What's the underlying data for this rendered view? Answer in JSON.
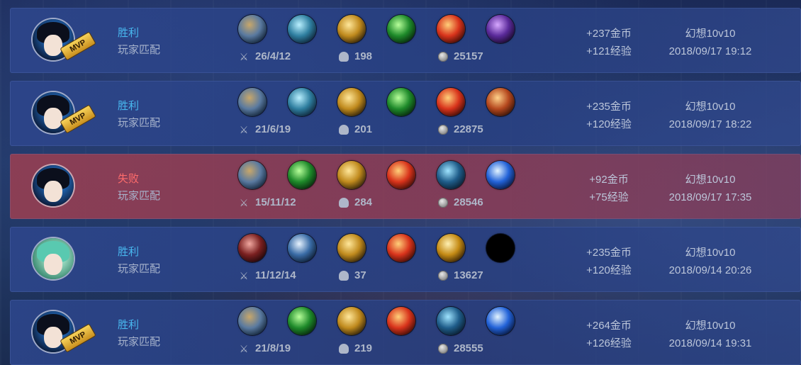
{
  "matches": [
    {
      "result": "胜利",
      "mode": "玩家匹配",
      "mvp": true,
      "mvp_label": "MVP",
      "avatar": "swordsman-portrait",
      "items": [
        "boots",
        "swordb",
        "gold",
        "green",
        "fire",
        "purple"
      ],
      "kda": "26/4/12",
      "deaths_stat": "198",
      "gold_stat": "25157",
      "gold_reward": "+237金币",
      "exp_reward": "+121经验",
      "map": "幻想10v10",
      "time": "2018/09/17 19:12"
    },
    {
      "result": "胜利",
      "mode": "玩家匹配",
      "mvp": true,
      "mvp_label": "MVP",
      "avatar": "swordsman-portrait",
      "items": [
        "boots",
        "swordb",
        "gold",
        "green",
        "fire",
        "amber"
      ],
      "kda": "21/6/19",
      "deaths_stat": "201",
      "gold_stat": "22875",
      "gold_reward": "+235金币",
      "exp_reward": "+120经验",
      "map": "幻想10v10",
      "time": "2018/09/17 18:22"
    },
    {
      "result": "失败",
      "mode": "玩家匹配",
      "mvp": false,
      "mvp_label": "",
      "avatar": "swordsman-portrait",
      "items": [
        "boots",
        "green",
        "gold",
        "fire",
        "bluering",
        "electric"
      ],
      "kda": "15/11/12",
      "deaths_stat": "284",
      "gold_stat": "28546",
      "gold_reward": "+92金币",
      "exp_reward": "+75经验",
      "map": "幻想10v10",
      "time": "2018/09/17 17:35"
    },
    {
      "result": "胜利",
      "mode": "玩家匹配",
      "mvp": false,
      "mvp_label": "",
      "avatar": "green-hair-portrait",
      "items": [
        "redsword",
        "armor",
        "gold",
        "fire",
        "spear",
        "empty"
      ],
      "kda": "11/12/14",
      "deaths_stat": "37",
      "gold_stat": "13627",
      "gold_reward": "+235金币",
      "exp_reward": "+120经验",
      "map": "幻想10v10",
      "time": "2018/09/14 20:26"
    },
    {
      "result": "胜利",
      "mode": "玩家匹配",
      "mvp": true,
      "mvp_label": "MVP",
      "avatar": "swordsman-portrait",
      "items": [
        "boots",
        "green",
        "gold",
        "fire",
        "bluering",
        "electric"
      ],
      "kda": "21/8/19",
      "deaths_stat": "219",
      "gold_stat": "28555",
      "gold_reward": "+264金币",
      "exp_reward": "+126经验",
      "map": "幻想10v10",
      "time": "2018/09/14 19:31"
    }
  ],
  "colors": {
    "win_text": "#49b8ef",
    "loss_text": "#ff6c6c",
    "row_win_bg": "#2d468c",
    "row_loss_bg": "#963e52"
  }
}
